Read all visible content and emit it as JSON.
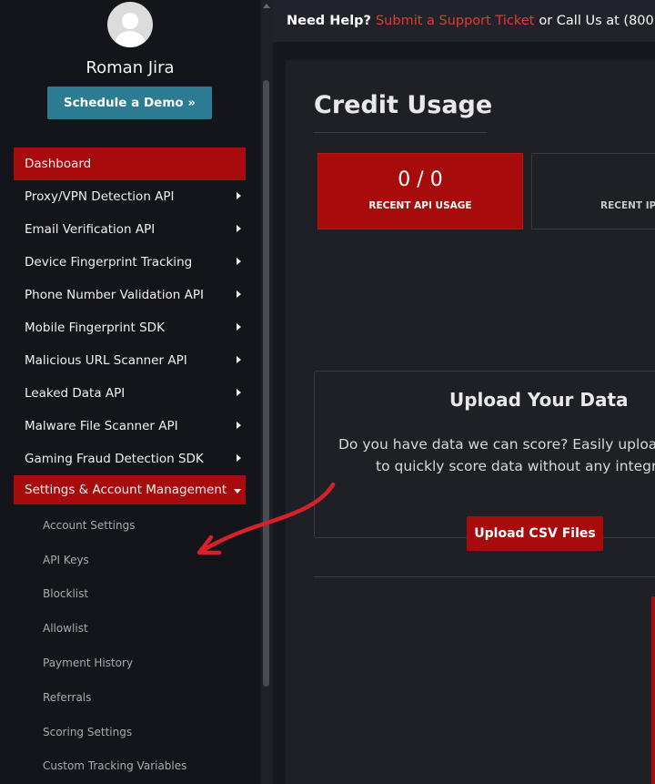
{
  "user": {
    "name": "Roman Jira"
  },
  "demo_button": {
    "label": "Schedule a Demo »"
  },
  "menu": {
    "items": [
      {
        "label": "Dashboard"
      },
      {
        "label": "Proxy/VPN Detection API"
      },
      {
        "label": "Email Verification API"
      },
      {
        "label": "Device Fingerprint Tracking"
      },
      {
        "label": "Phone Number Validation API"
      },
      {
        "label": "Mobile Fingerprint SDK"
      },
      {
        "label": "Malicious URL Scanner API"
      },
      {
        "label": "Leaked Data API"
      },
      {
        "label": "Malware File Scanner API"
      },
      {
        "label": "Gaming Fraud Detection SDK"
      },
      {
        "label": "Settings & Account Management"
      }
    ],
    "submenu": [
      {
        "label": "Account Settings"
      },
      {
        "label": "API Keys"
      },
      {
        "label": "Blocklist"
      },
      {
        "label": "Allowlist"
      },
      {
        "label": "Payment History"
      },
      {
        "label": "Referrals"
      },
      {
        "label": "Scoring Settings"
      },
      {
        "label": "Custom Tracking Variables"
      }
    ]
  },
  "topbar": {
    "help": "Need Help?",
    "ticket_link": "Submit a Support Ticket",
    "call": "or Call Us at (800"
  },
  "credit": {
    "title": "Credit Usage",
    "cards": [
      {
        "value": "0 / 0",
        "label": "RECENT API USAGE"
      },
      {
        "label": "RECENT IP A"
      }
    ]
  },
  "upload": {
    "title": "Upload Your Data",
    "line1": "Do you have data we can score? Easily uploa",
    "line2": "to quickly score data without any integr",
    "button": "Upload CSV Files"
  },
  "colors": {
    "accent_red": "#a80b0b",
    "demo_blue": "#2b7c93",
    "link_red": "#e53935"
  }
}
